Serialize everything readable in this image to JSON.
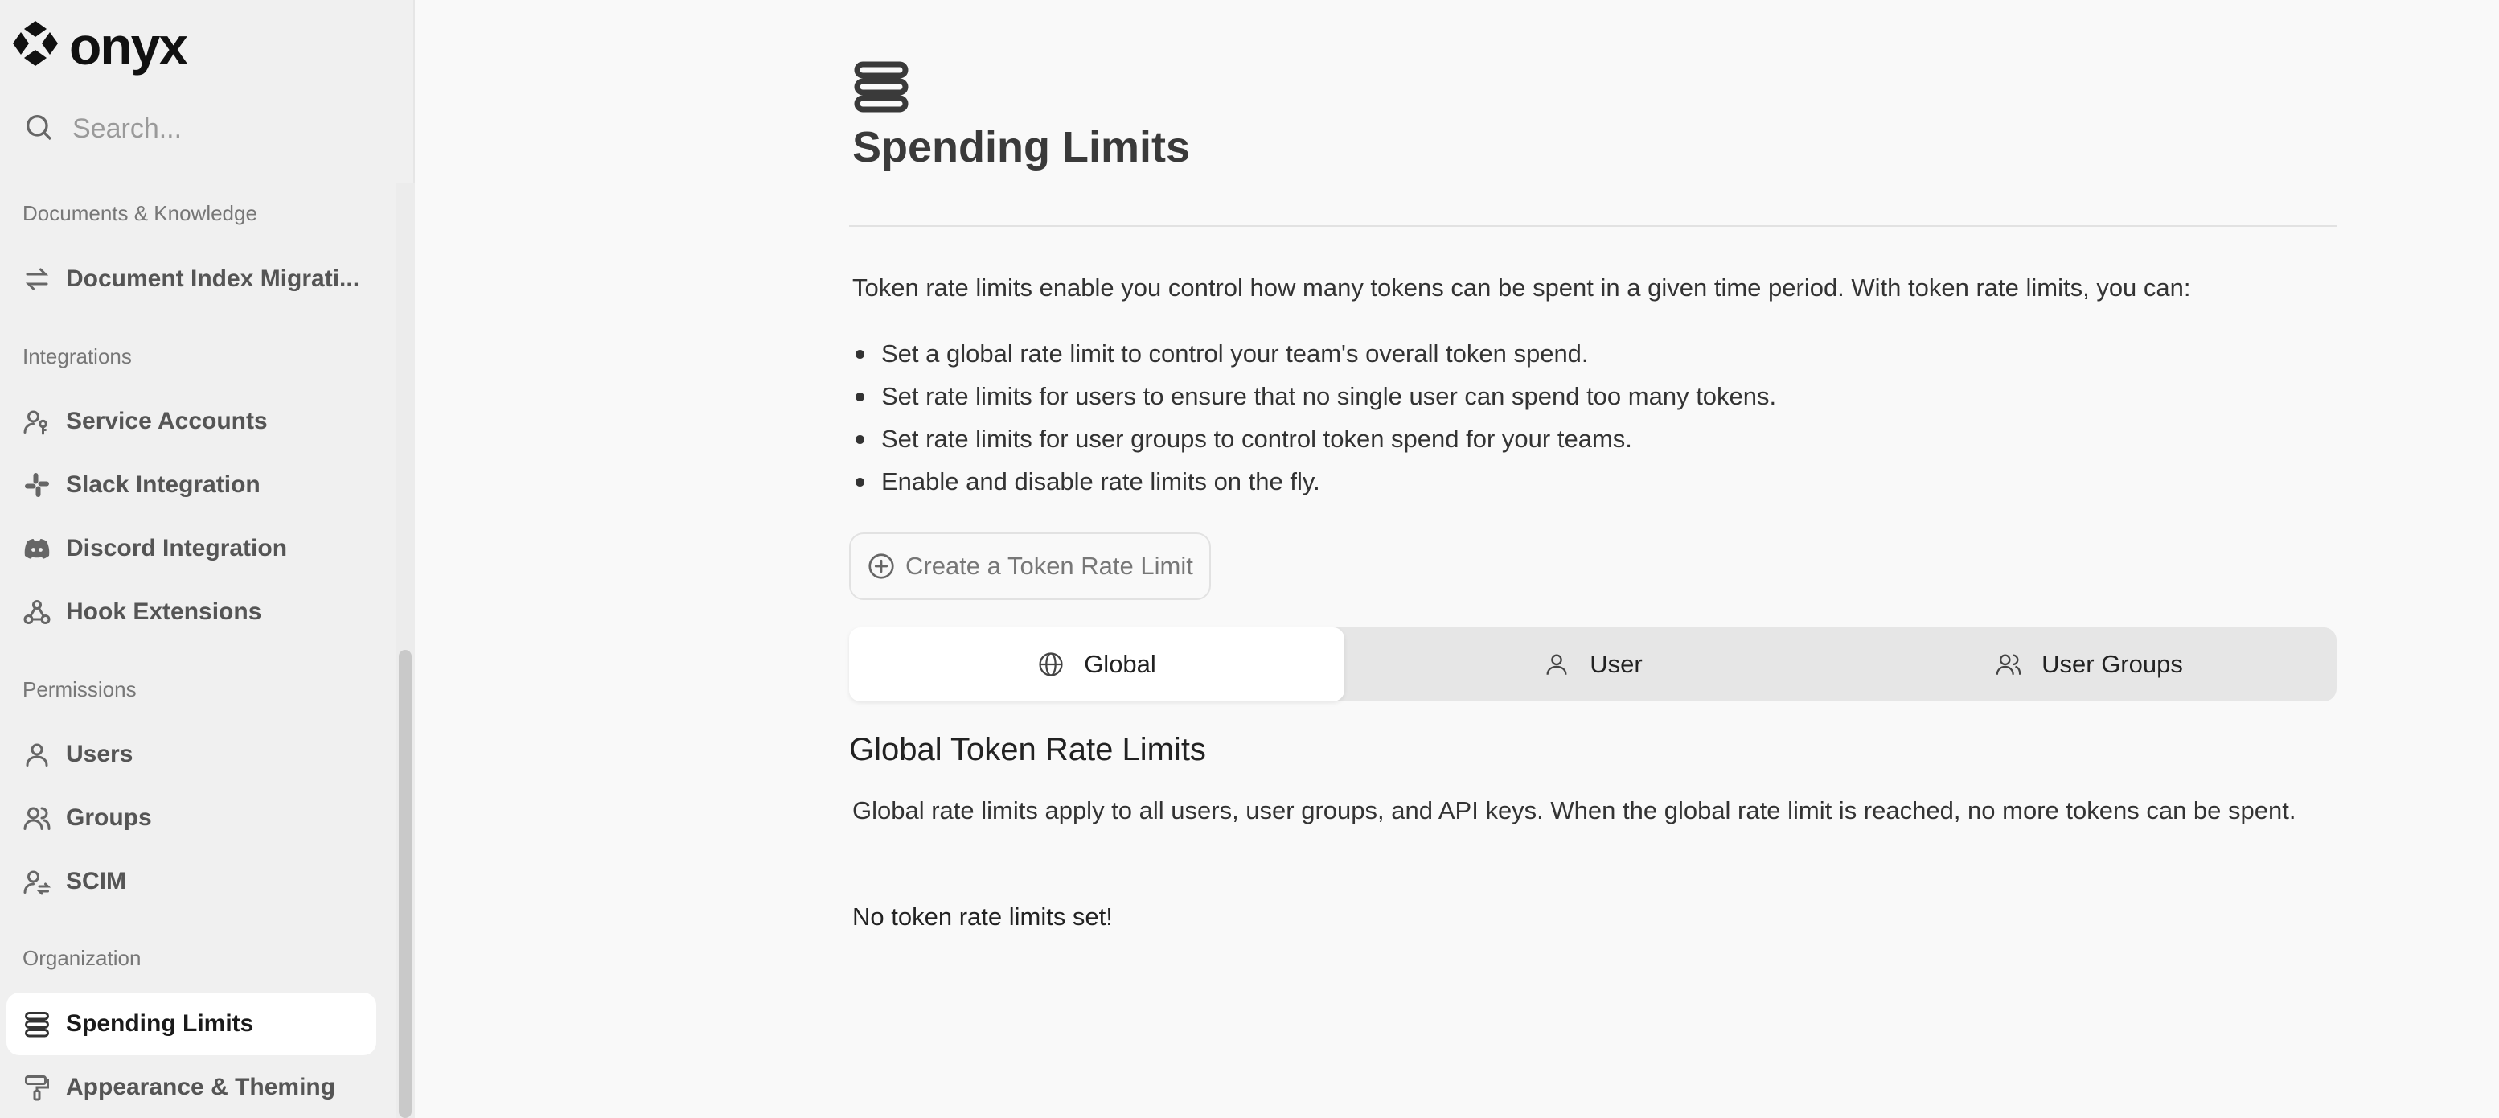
{
  "app": {
    "name": "onyx"
  },
  "search": {
    "placeholder": "Search..."
  },
  "sidebar": {
    "sections": [
      {
        "title": "Documents & Knowledge",
        "items": [
          {
            "label": "Document Index Migrati...",
            "icon": "swap-arrows-icon"
          }
        ]
      },
      {
        "title": "Integrations",
        "items": [
          {
            "label": "Service Accounts",
            "icon": "user-key-icon"
          },
          {
            "label": "Slack Integration",
            "icon": "slack-icon"
          },
          {
            "label": "Discord Integration",
            "icon": "discord-icon"
          },
          {
            "label": "Hook Extensions",
            "icon": "webhook-icon"
          }
        ]
      },
      {
        "title": "Permissions",
        "items": [
          {
            "label": "Users",
            "icon": "user-icon"
          },
          {
            "label": "Groups",
            "icon": "users-icon"
          },
          {
            "label": "SCIM",
            "icon": "user-sync-icon"
          }
        ]
      },
      {
        "title": "Organization",
        "items": [
          {
            "label": "Spending Limits",
            "icon": "server-stack-icon",
            "active": true
          },
          {
            "label": "Appearance & Theming",
            "icon": "paint-roller-icon"
          }
        ]
      }
    ]
  },
  "main": {
    "title": "Spending Limits",
    "intro": "Token rate limits enable you control how many tokens can be spent in a given time period. With token rate limits, you can:",
    "bullets": [
      "Set a global rate limit to control your team's overall token spend.",
      "Set rate limits for users to ensure that no single user can spend too many tokens.",
      "Set rate limits for user groups to control token spend for your teams.",
      "Enable and disable rate limits on the fly."
    ],
    "create_button": "Create a Token Rate Limit",
    "tabs": [
      {
        "label": "Global",
        "icon": "globe-icon",
        "active": true
      },
      {
        "label": "User",
        "icon": "user-icon"
      },
      {
        "label": "User Groups",
        "icon": "users-icon"
      }
    ],
    "section_title": "Global Token Rate Limits",
    "section_description": "Global rate limits apply to all users, user groups, and API keys. When the global rate limit is reached, no more tokens can be spent.",
    "empty_state": "No token rate limits set!"
  }
}
